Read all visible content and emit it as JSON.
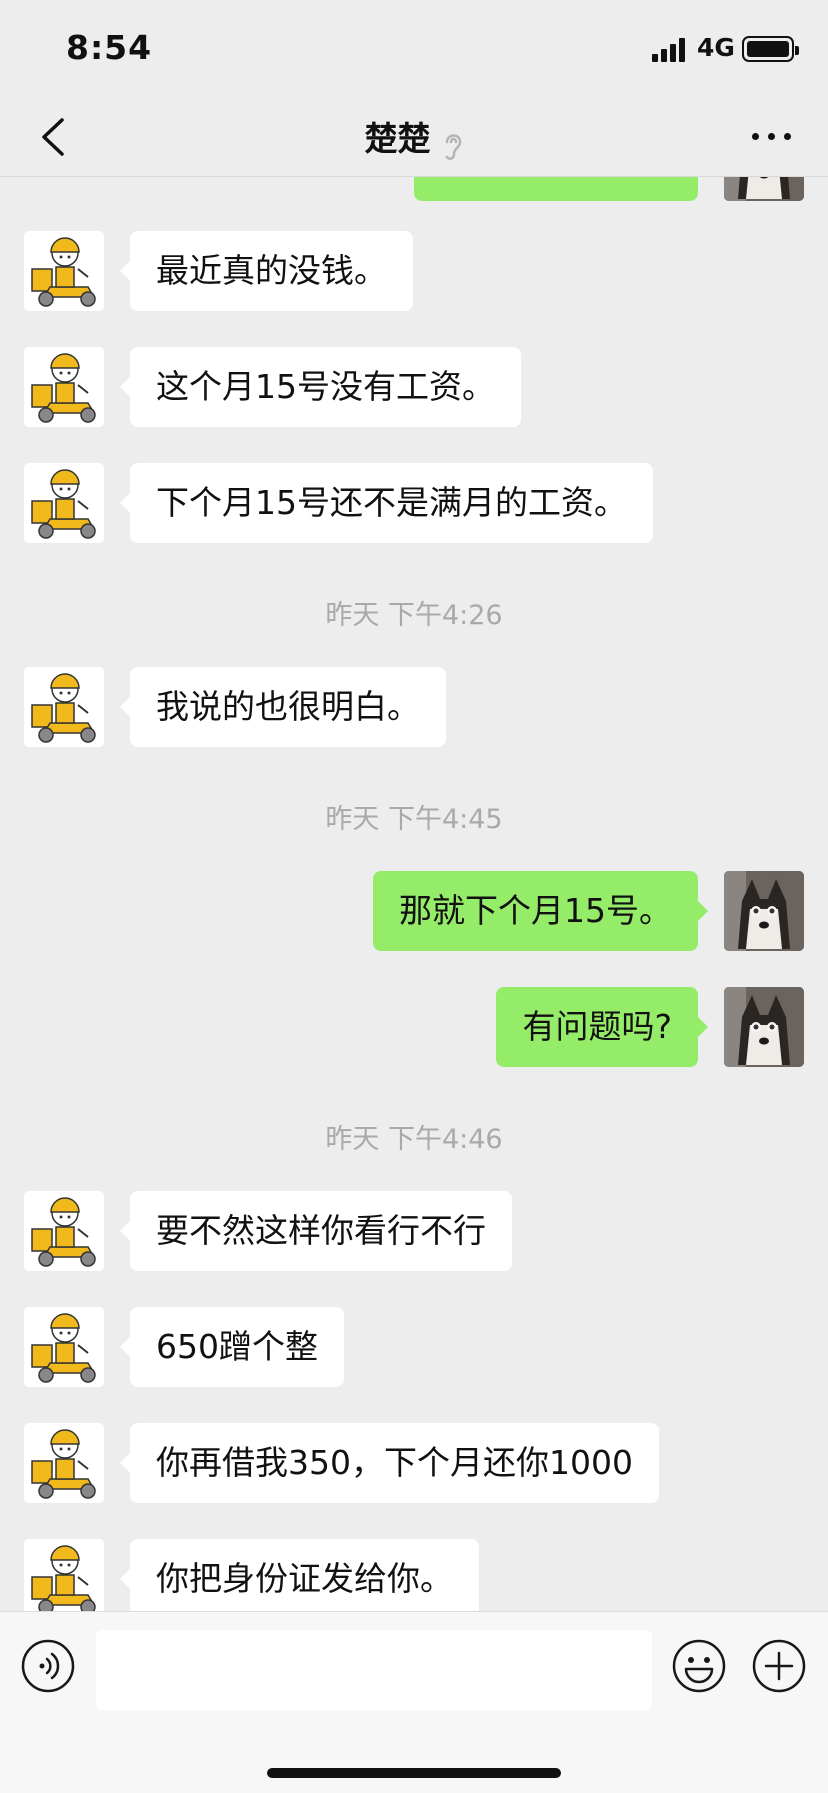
{
  "status": {
    "time": "8:54",
    "network": "4G"
  },
  "header": {
    "title": "楚楚"
  },
  "icons": {
    "back": "chevron-left-icon",
    "earpiece": "ear-icon",
    "more": "more-dots-icon",
    "voice": "voice-icon",
    "emoji": "smiley-icon",
    "plus": "plus-icon"
  },
  "colors": {
    "outgoing_bubble": "#95ec69",
    "incoming_bubble": "#ffffff",
    "background": "#ededed",
    "timestamp": "#a9a9a9"
  },
  "messages": [
    {
      "text": "最近真的没钱。"
    },
    {
      "text": "这个月15号没有工资。"
    },
    {
      "text": "下个月15号还不是满月的工资。"
    },
    {
      "timestamp": "昨天 下午4:26"
    },
    {
      "text": "我说的也很明白。"
    },
    {
      "timestamp": "昨天 下午4:45"
    },
    {
      "text": "那就下个月15号。"
    },
    {
      "text": "有问题吗?"
    },
    {
      "timestamp": "昨天 下午4:46"
    },
    {
      "text": "要不然这样你看行不行"
    },
    {
      "text": "650蹭个整"
    },
    {
      "text": "你再借我350，下个月还你1000"
    },
    {
      "text": "你把身份证发给你。"
    }
  ]
}
